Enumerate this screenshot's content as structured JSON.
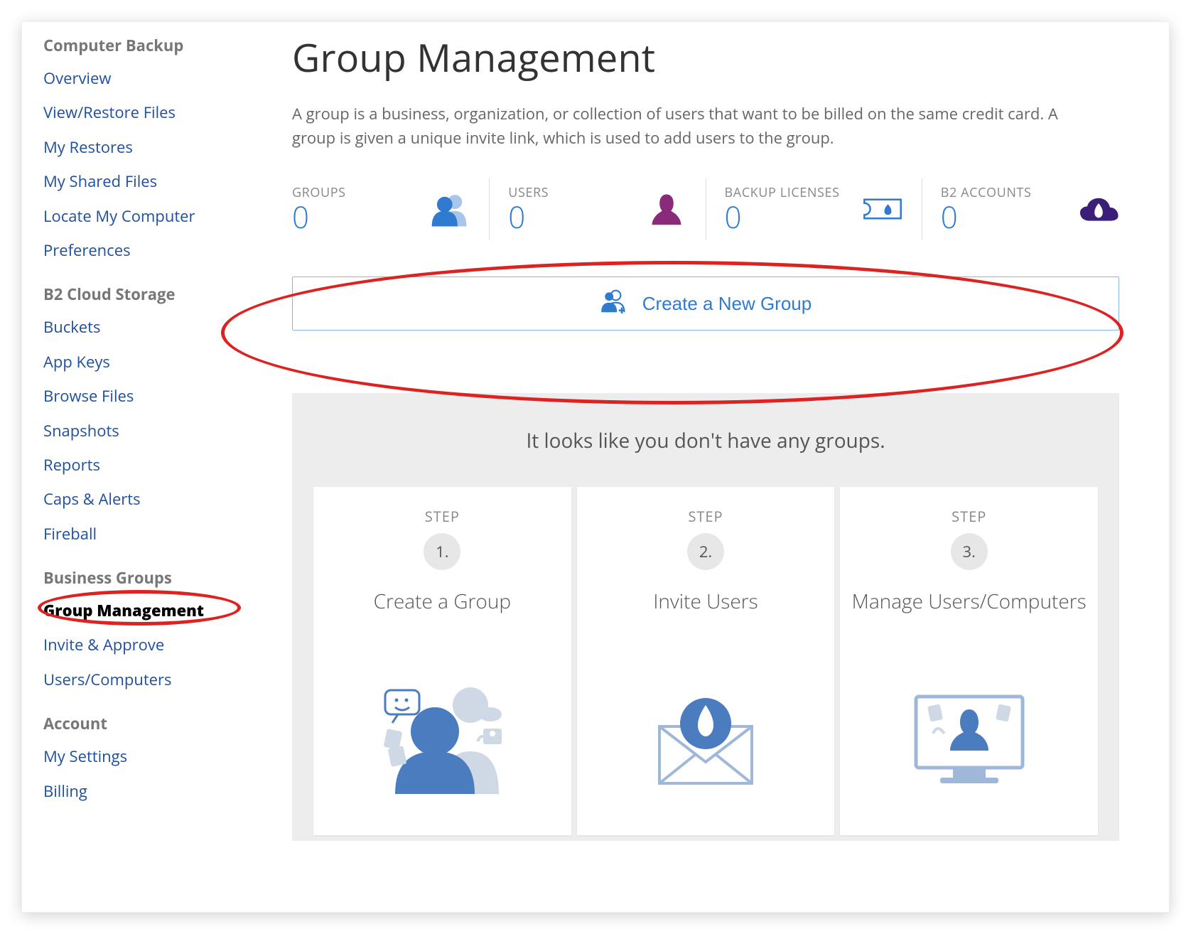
{
  "sidebar": {
    "sections": [
      {
        "heading": "Computer Backup",
        "items": [
          {
            "label": "Overview"
          },
          {
            "label": "View/Restore Files"
          },
          {
            "label": "My Restores"
          },
          {
            "label": "My Shared Files"
          },
          {
            "label": "Locate My Computer"
          },
          {
            "label": "Preferences"
          }
        ]
      },
      {
        "heading": "B2 Cloud Storage",
        "items": [
          {
            "label": "Buckets"
          },
          {
            "label": "App Keys"
          },
          {
            "label": "Browse Files"
          },
          {
            "label": "Snapshots"
          },
          {
            "label": "Reports"
          },
          {
            "label": "Caps & Alerts"
          },
          {
            "label": "Fireball"
          }
        ]
      },
      {
        "heading": "Business Groups",
        "items": [
          {
            "label": "Group Management",
            "active": true
          },
          {
            "label": "Invite & Approve"
          },
          {
            "label": "Users/Computers"
          }
        ]
      },
      {
        "heading": "Account",
        "items": [
          {
            "label": "My Settings"
          },
          {
            "label": "Billing"
          }
        ]
      }
    ]
  },
  "page": {
    "title": "Group Management",
    "description": "A group is a business, organization, or collection of users that want to be billed on the same credit card. A group is given a unique invite link, which is used to add users to the group."
  },
  "stats": [
    {
      "label": "GROUPS",
      "value": "0",
      "icon": "groups-icon",
      "color": "#2e7bd0"
    },
    {
      "label": "USERS",
      "value": "0",
      "icon": "user-icon",
      "color": "#8a2b7a"
    },
    {
      "label": "BACKUP LICENSES",
      "value": "0",
      "icon": "license-icon",
      "color": "#2e7bd0"
    },
    {
      "label": "B2 ACCOUNTS",
      "value": "0",
      "icon": "cloud-icon",
      "color": "#3a1e78"
    }
  ],
  "create_button": {
    "label": "Create a New Group"
  },
  "empty": {
    "message": "It looks like you don't have any groups.",
    "step_pre": "STEP",
    "steps": [
      {
        "num": "1.",
        "title": "Create a Group"
      },
      {
        "num": "2.",
        "title": "Invite Users"
      },
      {
        "num": "3.",
        "title": "Manage Users/Computers"
      }
    ]
  },
  "colors": {
    "accent_blue": "#2e7bd0",
    "link_blue": "#1e4f9e",
    "purple": "#8a2b7a",
    "dark_purple": "#3a1e78",
    "annotation_red": "#d22222"
  }
}
